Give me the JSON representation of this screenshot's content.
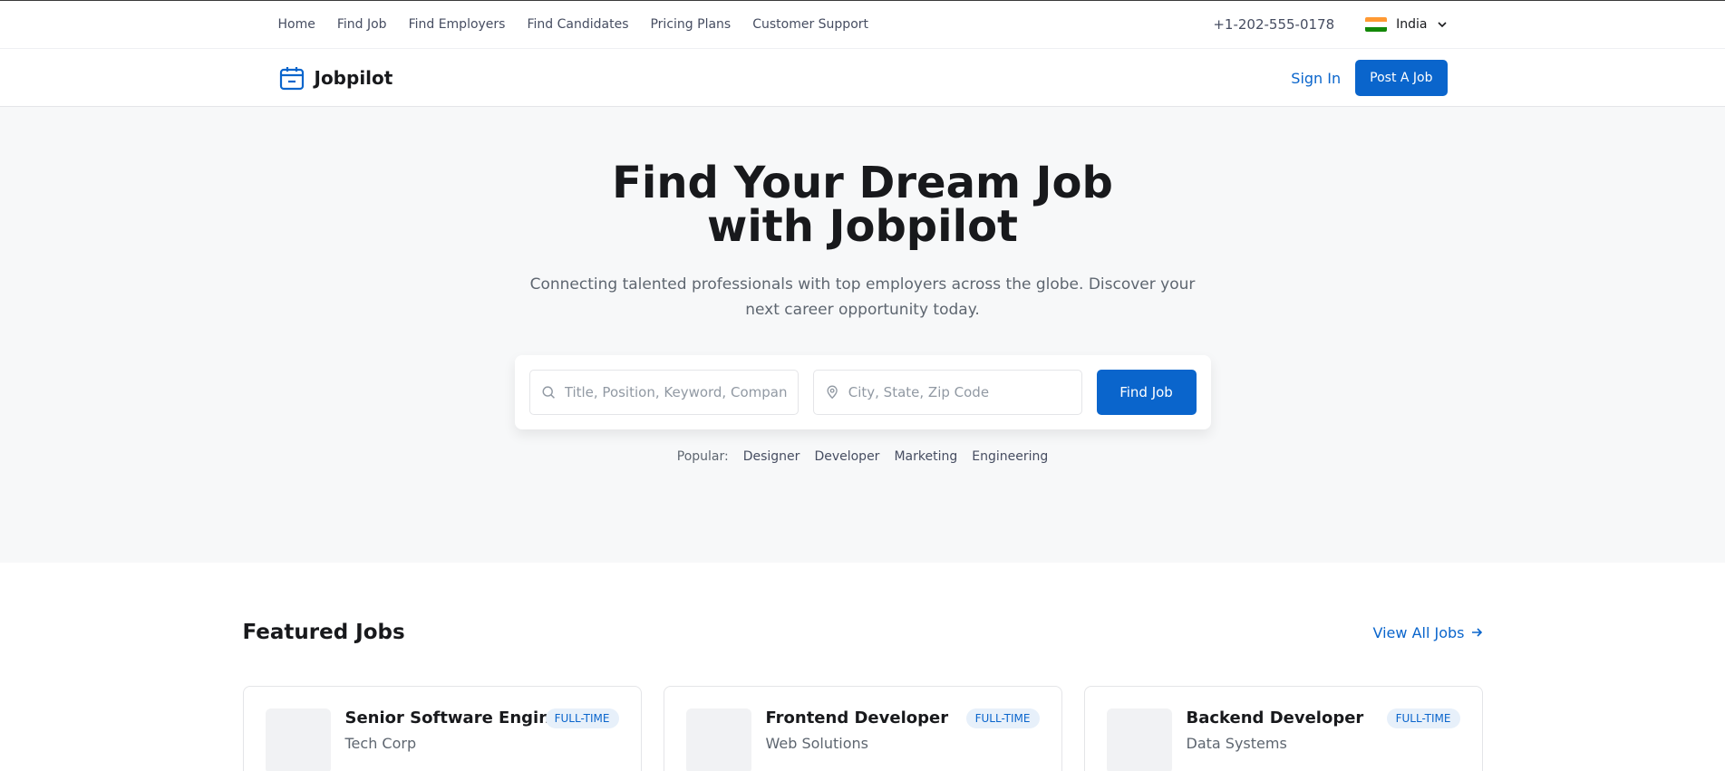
{
  "topbar": {
    "nav": [
      "Home",
      "Find Job",
      "Find Employers",
      "Find Candidates",
      "Pricing Plans",
      "Customer Support"
    ],
    "phone": "+1-202-555-0178",
    "language": "India"
  },
  "header": {
    "brand": "Jobpilot",
    "sign_in": "Sign In",
    "post_job": "Post A Job"
  },
  "hero": {
    "title": "Find Your Dream Job with Jobpilot",
    "subtitle": "Connecting talented professionals with top employers across the globe. Discover your next career opportunity today.",
    "search": {
      "title_placeholder": "Title, Position, Keyword, Company",
      "location_placeholder": "City, State, Zip Code",
      "button": "Find Job"
    },
    "popular_label": "Popular:",
    "popular_tags": [
      "Designer",
      "Developer",
      "Marketing",
      "Engineering"
    ]
  },
  "featured": {
    "title": "Featured Jobs",
    "view_all": "View All Jobs",
    "jobs": [
      {
        "title": "Senior Software Engineer",
        "company": "Tech Corp",
        "type": "FULL-TIME"
      },
      {
        "title": "Frontend Developer",
        "company": "Web Solutions",
        "type": "FULL-TIME"
      },
      {
        "title": "Backend Developer",
        "company": "Data Systems",
        "type": "FULL-TIME"
      }
    ]
  },
  "colors": {
    "accent": "#0a65cc",
    "hero_bg": "#f7f8f9"
  }
}
